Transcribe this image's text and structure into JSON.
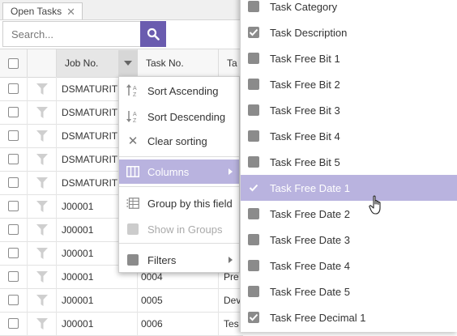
{
  "tab": {
    "label": "Open Tasks"
  },
  "search": {
    "placeholder": "Search..."
  },
  "grid": {
    "headers": {
      "job_no": "Job No.",
      "task_no": "Task No.",
      "partial": "Ta"
    },
    "rows": [
      {
        "job": "DSMATURIT",
        "task": "",
        "extra": ""
      },
      {
        "job": "DSMATURIT",
        "task": "",
        "extra": ""
      },
      {
        "job": "DSMATURIT",
        "task": "",
        "extra": ""
      },
      {
        "job": "DSMATURIT",
        "task": "",
        "extra": ""
      },
      {
        "job": "DSMATURIT",
        "task": "",
        "extra": ""
      },
      {
        "job": "J00001",
        "task": "",
        "extra": ""
      },
      {
        "job": "J00001",
        "task": "",
        "extra": ""
      },
      {
        "job": "J00001",
        "task": "",
        "extra": ""
      },
      {
        "job": "J00001",
        "task": "0004",
        "extra": "Pre"
      },
      {
        "job": "J00001",
        "task": "0005",
        "extra": "Dev"
      },
      {
        "job": "J00001",
        "task": "0006",
        "extra": "Tes"
      }
    ]
  },
  "menu": {
    "sort_asc": "Sort Ascending",
    "sort_desc": "Sort Descending",
    "clear_sort": "Clear sorting",
    "columns": "Columns",
    "group_by": "Group by this field",
    "show_in_groups": "Show in Groups",
    "filters": "Filters"
  },
  "columns_submenu": [
    {
      "label": "Task Category",
      "checked": false
    },
    {
      "label": "Task Description",
      "checked": true
    },
    {
      "label": "Task Free Bit 1",
      "checked": false
    },
    {
      "label": "Task Free Bit 2",
      "checked": false
    },
    {
      "label": "Task Free Bit 3",
      "checked": false
    },
    {
      "label": "Task Free Bit 4",
      "checked": false
    },
    {
      "label": "Task Free Bit 5",
      "checked": false
    },
    {
      "label": "Task Free Date 1",
      "checked": true,
      "highlighted": true
    },
    {
      "label": "Task Free Date 2",
      "checked": false
    },
    {
      "label": "Task Free Date 3",
      "checked": false
    },
    {
      "label": "Task Free Date 4",
      "checked": false
    },
    {
      "label": "Task Free Date 5",
      "checked": false
    },
    {
      "label": "Task Free Decimal 1",
      "checked": true
    }
  ],
  "colors": {
    "accent": "#6a5caf",
    "highlight": "#b9b3df"
  }
}
